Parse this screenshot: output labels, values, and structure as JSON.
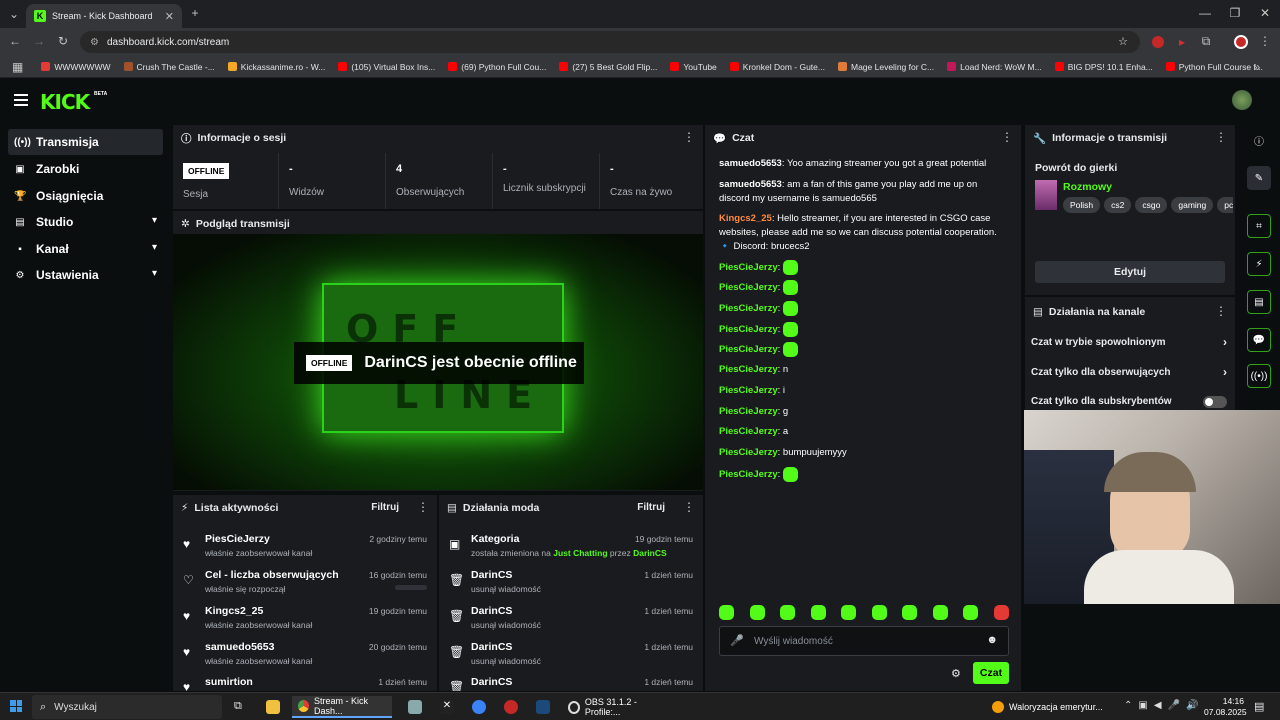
{
  "browser": {
    "tab_title": "Stream - Kick Dashboard",
    "url": "dashboard.kick.com/stream",
    "bookmarks": [
      {
        "label": "WWWWWWW",
        "color": "#e53935"
      },
      {
        "label": "Crush The Castle -...",
        "color": "#a0522d"
      },
      {
        "label": "Kickassanime.ro - W...",
        "color": "#f9a825"
      },
      {
        "label": "(105) Virtual Box Ins...",
        "color": "#ff0000"
      },
      {
        "label": "(69) Python Full Cou...",
        "color": "#ff0000"
      },
      {
        "label": "(27) 5 Best Gold Flip...",
        "color": "#ff0000"
      },
      {
        "label": "YouTube",
        "color": "#ff0000"
      },
      {
        "label": "Kronkel Dom - Gute...",
        "color": "#ff0000"
      },
      {
        "label": "Mage Leveling for C...",
        "color": "#e07b39"
      },
      {
        "label": "Load Nerd: WoW M...",
        "color": "#c2185b"
      },
      {
        "label": "BIG DPS! 10.1 Enha...",
        "color": "#ff0000"
      },
      {
        "label": "Python Full Course f...",
        "color": "#ff0000"
      }
    ]
  },
  "app": {
    "logo": "KICK",
    "beta": "BETA"
  },
  "sidebar": {
    "items": [
      {
        "label": "Transmisja",
        "icon": "broadcast-icon"
      },
      {
        "label": "Zarobki",
        "icon": "wallet-icon"
      },
      {
        "label": "Osiągnięcia",
        "icon": "trophy-icon"
      },
      {
        "label": "Studio",
        "icon": "studio-icon"
      },
      {
        "label": "Kanał",
        "icon": "channel-icon"
      },
      {
        "label": "Ustawienia",
        "icon": "gear-icon"
      }
    ]
  },
  "session": {
    "title": "Informacje o sesji",
    "badge": "OFFLINE",
    "stats": [
      {
        "value": "",
        "label": "Sesja"
      },
      {
        "value": "-",
        "label": "Widzów"
      },
      {
        "value": "4",
        "label": "Obserwujących"
      },
      {
        "value": "-",
        "label": "Licznik subskrypcji"
      },
      {
        "value": "-",
        "label": "Czas na żywo"
      }
    ]
  },
  "preview": {
    "title": "Podgląd transmisji",
    "sign_top": "OFF",
    "sign_bottom": "LINE",
    "badge": "OFFLINE",
    "message": "DarinCS jest obecnie offline"
  },
  "activity": {
    "title": "Lista aktywności",
    "filter": "Filtruj",
    "items": [
      {
        "name": "PiesCieJerzy",
        "sub": "właśnie zaobserwował kanał",
        "time": "2 godziny temu"
      },
      {
        "name": "Cel - liczba obserwujących",
        "sub": "właśnie się rozpoczął",
        "time": "16 godzin temu"
      },
      {
        "name": "Kingcs2_25",
        "sub": "właśnie zaobserwował kanał",
        "time": "19 godzin temu"
      },
      {
        "name": "samuedo5653",
        "sub": "właśnie zaobserwował kanał",
        "time": "20 godzin temu"
      },
      {
        "name": "sumirtion",
        "sub": "",
        "time": "1 dzień temu"
      }
    ]
  },
  "mod": {
    "title": "Działania moda",
    "filter": "Filtruj",
    "first": {
      "name": "Kategoria",
      "pre": "została zmieniona na",
      "cat": "Just Chatting",
      "mid": "przez",
      "by": "DarinCS",
      "time": "19 godzin temu"
    },
    "items": [
      {
        "name": "DarinCS",
        "sub": "usunął wiadomość",
        "time": "1 dzień temu"
      },
      {
        "name": "DarinCS",
        "sub": "usunął wiadomość",
        "time": "1 dzień temu"
      },
      {
        "name": "DarinCS",
        "sub": "usunął wiadomość",
        "time": "1 dzień temu"
      },
      {
        "name": "DarinCS",
        "sub": "",
        "time": "1 dzień temu"
      }
    ]
  },
  "chat": {
    "title": "Czat",
    "messages": [
      {
        "user": "samuedo5653",
        "color": "#ffffff",
        "text": "Yoo amazing streamer you got a great potential"
      },
      {
        "user": "samuedo5653",
        "color": "#ffffff",
        "text": "am a fan of this game you play add me up on discord my username is samuedo565"
      },
      {
        "user": "Kingcs2_25",
        "color": "#ff8a3d",
        "text": "Hello streamer, if you are interested in CSGO case websites, please add me so we can discuss potential cooperation. 🔹 Discord: brucecs2"
      },
      {
        "user": "PiesCieJerzy",
        "color": "#53fc18",
        "text": "",
        "emote": true
      },
      {
        "user": "PiesCieJerzy",
        "color": "#53fc18",
        "text": "",
        "emote": true
      },
      {
        "user": "PiesCieJerzy",
        "color": "#53fc18",
        "text": "",
        "emote": true
      },
      {
        "user": "PiesCieJerzy",
        "color": "#53fc18",
        "text": "",
        "emote": true
      },
      {
        "user": "PiesCieJerzy",
        "color": "#53fc18",
        "text": "",
        "emote": true
      },
      {
        "user": "PiesCieJerzy",
        "color": "#53fc18",
        "text": "n"
      },
      {
        "user": "PiesCieJerzy",
        "color": "#53fc18",
        "text": "i"
      },
      {
        "user": "PiesCieJerzy",
        "color": "#53fc18",
        "text": "g"
      },
      {
        "user": "PiesCieJerzy",
        "color": "#53fc18",
        "text": "a"
      },
      {
        "user": "PiesCieJerzy",
        "color": "#53fc18",
        "text": "bumpuujemyyy"
      },
      {
        "user": "PiesCieJerzy",
        "color": "#53fc18",
        "text": "",
        "emote": true
      }
    ],
    "placeholder": "Wyślij wiadomość",
    "send": "Czat"
  },
  "streaminfo": {
    "title": "Informacje o transmisji",
    "game_title": "Powrót do gierki",
    "category": "Rozmowy",
    "tags": [
      "Polish",
      "cs2",
      "csgo",
      "gaming",
      "pc"
    ],
    "edit": "Edytuj"
  },
  "channel_actions": {
    "title": "Działania na kanale",
    "items": [
      "Czat w trybie spowolnionym",
      "Czat tylko dla obserwujących",
      "Czat tylko dla subskrybentów"
    ]
  },
  "taskbar": {
    "search": "Wyszukaj",
    "chrome": "Stream - Kick Dash...",
    "obs": "OBS 31.1.2 - Profile:...",
    "news": "Waloryzacja emerytur...",
    "time": "14:16",
    "date": "07.08.2025"
  },
  "colors": {
    "accent": "#53fc18",
    "panel": "#191b1f",
    "bg": "#0b0e0f"
  }
}
